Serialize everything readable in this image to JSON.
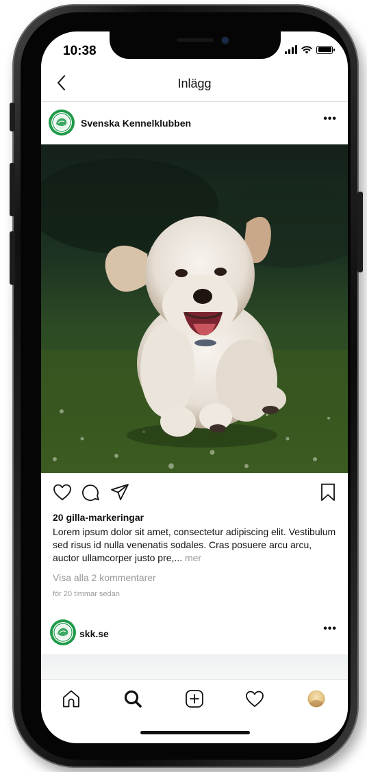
{
  "status_bar": {
    "time": "10:38"
  },
  "navbar": {
    "title": "Inlägg"
  },
  "post": {
    "username": "Svenska Kennelklubben",
    "more": "•••",
    "likes": "20 gilla-markeringar",
    "caption": "Lorem ipsum dolor sit amet, consectetur adipiscing elit. Vestibulum sed risus id nulla venenatis sodales. Cras posuere arcu arcu, auctor ullamcorper justo pre,...",
    "more_label": "mer",
    "view_comments": "Visa alla 2 kommentarer",
    "time_ago": "för 20 timmar sedan"
  },
  "post2": {
    "username": "skk.se",
    "more": "•••"
  },
  "colors": {
    "logo_green": "#1f9a4a",
    "text": "#111111",
    "muted": "#9a9a9a",
    "grass": "#2f5a20"
  },
  "icons": {
    "actions": [
      "heart-icon",
      "comment-icon",
      "share-icon",
      "bookmark-icon"
    ],
    "tabbar": [
      "home-icon",
      "search-icon",
      "add-post-icon",
      "activity-heart-icon",
      "profile-avatar"
    ]
  }
}
